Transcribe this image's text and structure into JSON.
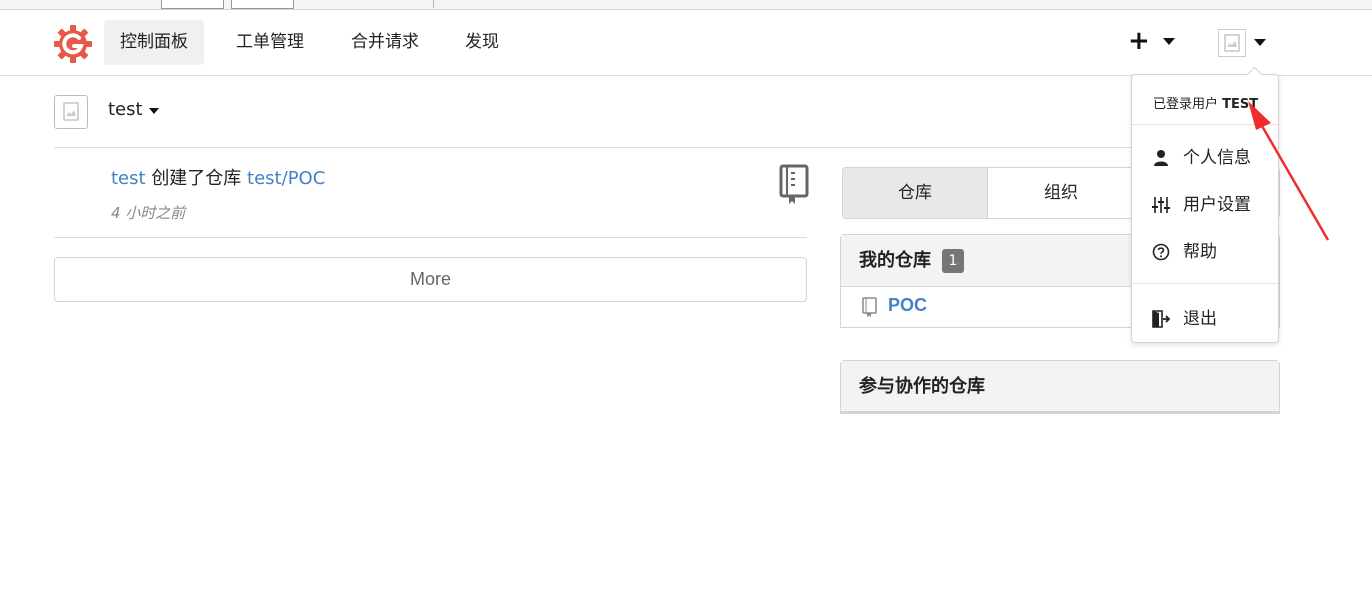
{
  "nav": {
    "items": [
      {
        "label": "控制面板",
        "active": true
      },
      {
        "label": "工单管理",
        "active": false
      },
      {
        "label": "合并请求",
        "active": false
      },
      {
        "label": "发现",
        "active": false
      }
    ],
    "plus_label": "+"
  },
  "context": {
    "user": "test"
  },
  "feed": {
    "actor": "test",
    "action": "创建了仓库",
    "repo_owner": "test",
    "repo_sep": "/",
    "repo_name": "POC",
    "time": "4 小时之前",
    "more_label": "More"
  },
  "side": {
    "tabs": [
      "仓库",
      "组织"
    ],
    "my_repos_title": "我的仓库",
    "my_repos_count": "1",
    "repos": [
      "POC"
    ],
    "collab_title": "参与协作的仓库"
  },
  "dropdown": {
    "header_prefix": "已登录用户",
    "header_user": "TEST",
    "items": [
      "个人信息",
      "用户设置",
      "帮助",
      "退出"
    ]
  },
  "colors": {
    "link": "#4183c4",
    "brand": "#e8584a",
    "annotation": "#f02d2d"
  }
}
